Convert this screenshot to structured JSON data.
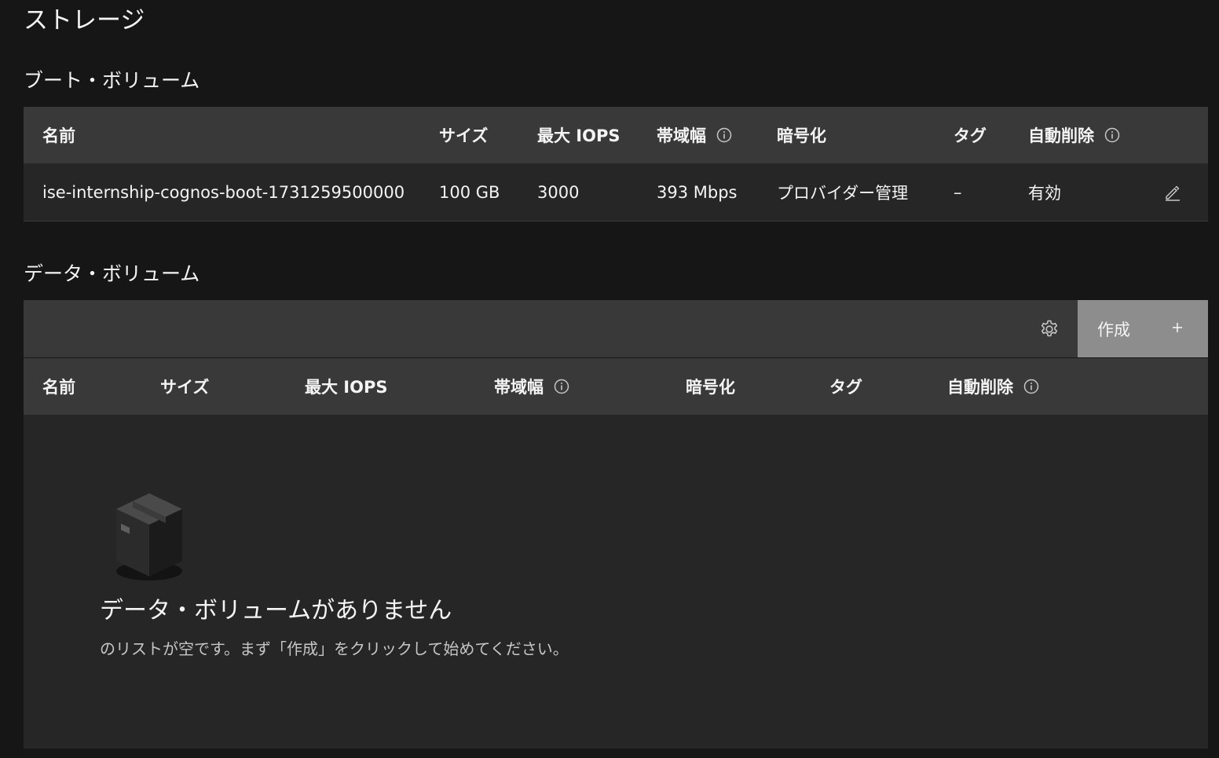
{
  "page": {
    "title": "ストレージ"
  },
  "boot_volume": {
    "title": "ブート・ボリューム",
    "columns": [
      "名前",
      "サイズ",
      "最大 IOPS",
      "帯域幅",
      "暗号化",
      "タグ",
      "自動削除"
    ],
    "rows": [
      {
        "name": "ise-internship-cognos-boot-1731259500000",
        "size": "100 GB",
        "max_iops": "3000",
        "bandwidth": "393 Mbps",
        "encryption": "プロバイダー管理",
        "tags": "–",
        "auto_delete": "有効"
      }
    ]
  },
  "data_volume": {
    "title": "データ・ボリューム",
    "create_label": "作成",
    "columns": [
      "名前",
      "サイズ",
      "最大 IOPS",
      "帯域幅",
      "暗号化",
      "タグ",
      "自動削除"
    ],
    "empty_title": "データ・ボリュームがありません",
    "empty_description": "のリストが空です。まず「作成」をクリックして始めてください。"
  },
  "icons": {
    "info": "info-icon",
    "edit": "edit-icon",
    "settings": "gear-icon",
    "add": "plus-icon",
    "empty": "box-icon"
  },
  "colors": {
    "background": "#161616",
    "header": "#393939",
    "row": "#262626",
    "button": "#8d8d8d",
    "text": "#f4f4f4"
  }
}
